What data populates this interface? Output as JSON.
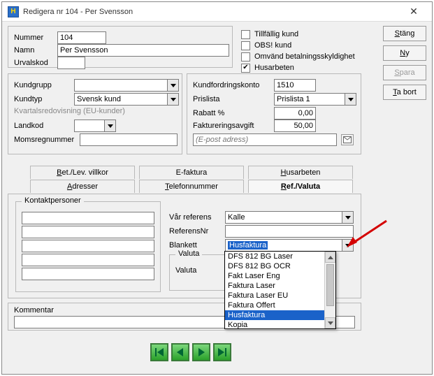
{
  "window": {
    "title": "Redigera nr 104 - Per Svensson"
  },
  "top": {
    "nummer_label": "Nummer",
    "nummer_value": "104",
    "namn_label": "Namn",
    "namn_value": "Per Svensson",
    "urvalskod_label": "Urvalskod",
    "urvalskod_value": ""
  },
  "flags": {
    "tillfallig": {
      "label": "Tillfällig kund",
      "checked": false
    },
    "obs": {
      "label": "OBS! kund",
      "checked": false
    },
    "omvand": {
      "label": "Omvänd betalningsskyldighet",
      "checked": false
    },
    "husarbeten": {
      "label": "Husarbeten",
      "checked": true
    }
  },
  "buttons": {
    "stang": "Stäng",
    "ny": "Ny",
    "spara": "Spara",
    "tabort": "Ta bort"
  },
  "left_panel": {
    "kundgrupp_label": "Kundgrupp",
    "kundgrupp_value": "",
    "kundtyp_label": "Kundtyp",
    "kundtyp_value": "Svensk kund",
    "kvartals_label": "Kvartalsredovisning (EU-kunder)",
    "landkod_label": "Landkod",
    "landkod_value": "",
    "momsreg_label": "Momsregnummer",
    "momsreg_value": ""
  },
  "right_panel": {
    "kundfordr_label": "Kundfordringskonto",
    "kundfordr_value": "1510",
    "prislista_label": "Prislista",
    "prislista_value": "Prislista 1",
    "rabatt_label": "Rabatt %",
    "rabatt_value": "0,00",
    "fakturavgift_label": "Faktureringsavgift",
    "fakturavgift_value": "50,00",
    "epost_placeholder": "(E-post adress)"
  },
  "tabs": {
    "row1": [
      "Bet./Lev. villkor",
      "E-faktura",
      "Husarbeten"
    ],
    "row2": [
      "Adresser",
      "Telefonnummer",
      "Ref./Valuta"
    ],
    "active": "Ref./Valuta"
  },
  "refvaluta": {
    "kontakt_legend": "Kontaktpersoner",
    "var_referens_label": "Vår referens",
    "var_referens_value": "Kalle",
    "referensnr_label": "ReferensNr",
    "referensnr_value": "",
    "blankett_label": "Blankett",
    "blankett_value": "Husfaktura",
    "valuta_group": "Valuta",
    "valuta_label": "Valuta",
    "blankett_options": [
      "DFS 812 BG Laser",
      "DFS 812 BG OCR",
      "Fakt Laser Eng",
      "Faktura Laser",
      "Faktura Laser EU",
      "Faktura Offert",
      "Husfaktura",
      "Kopia"
    ]
  },
  "kommentar": {
    "label": "Kommentar",
    "value": ""
  }
}
